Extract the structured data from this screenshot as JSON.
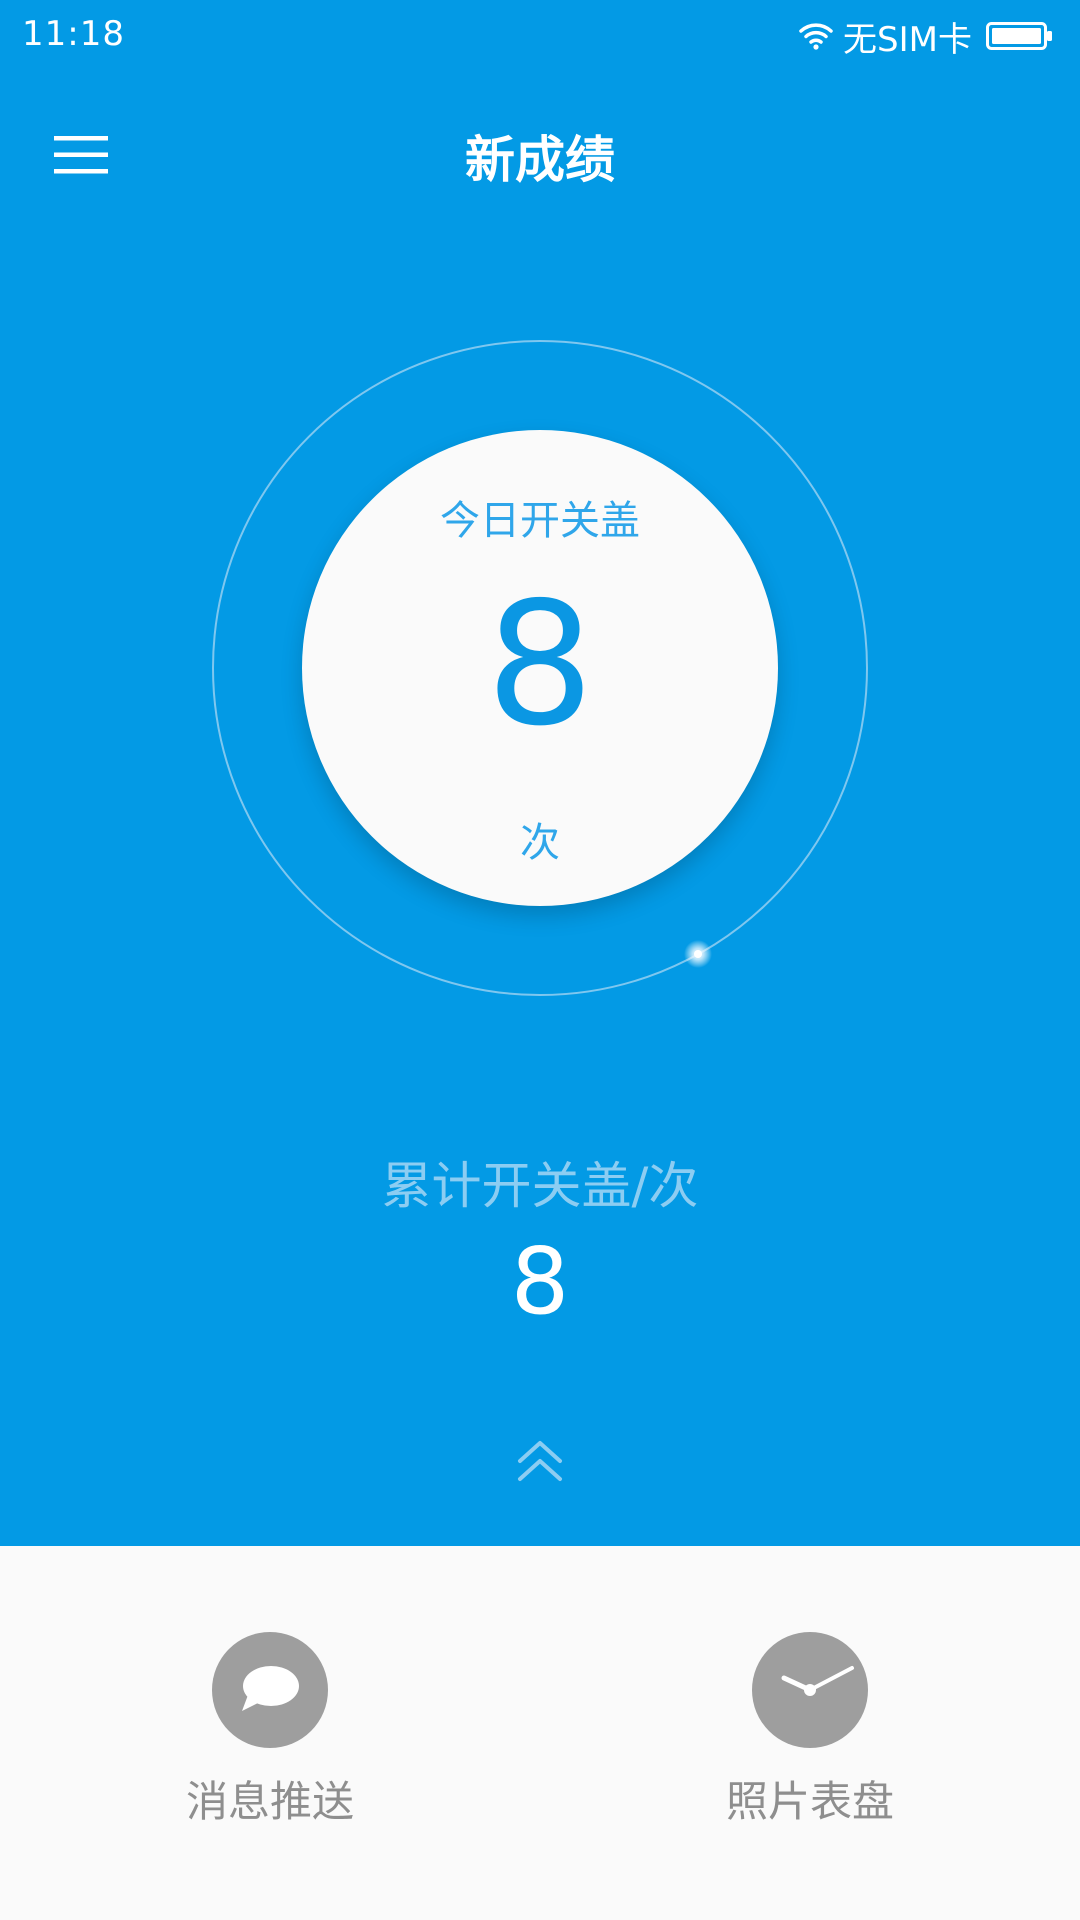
{
  "status_bar": {
    "time": "11:18",
    "sim_status": "无SIM卡",
    "wifi_icon": "wifi-icon",
    "battery_icon": "battery-icon"
  },
  "header": {
    "title": "新成绩",
    "menu_icon": "hamburger-menu-icon"
  },
  "today": {
    "label": "今日开关盖",
    "value": "8",
    "unit": "次"
  },
  "total": {
    "label": "累计开关盖/次",
    "value": "8"
  },
  "expand_icon": "double-chevron-up-icon",
  "bottom_nav": {
    "items": [
      {
        "label": "消息推送",
        "icon": "chat-bubble-icon"
      },
      {
        "label": "照片表盘",
        "icon": "clock-icon"
      }
    ]
  },
  "colors": {
    "primary_blue": "#039ae5",
    "accent_blue": "#0b97e3",
    "light_text": "#8ccdf2",
    "nav_icon_gray": "#9e9e9e",
    "nav_text_gray": "#8e8e8e",
    "background": "#fafafa"
  }
}
